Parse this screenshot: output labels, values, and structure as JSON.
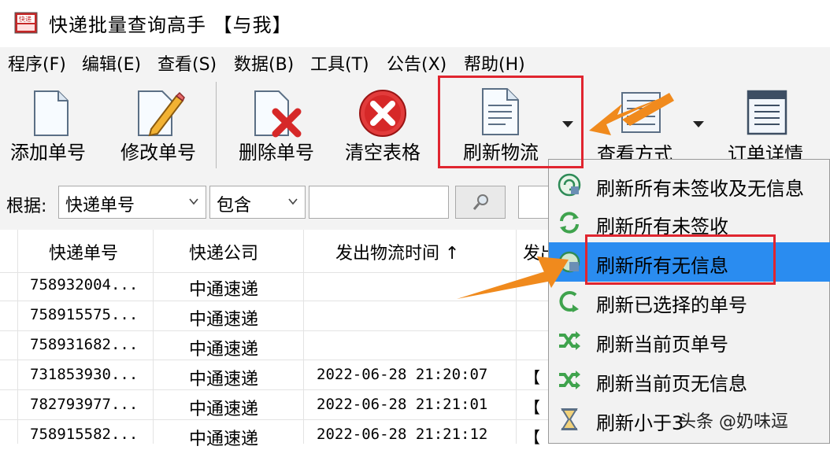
{
  "window": {
    "title": "快递批量查询高手 【与我】"
  },
  "menu": [
    "程序(F)",
    "编辑(E)",
    "查看(S)",
    "数据(B)",
    "工具(T)",
    "公告(X)",
    "帮助(H)"
  ],
  "toolbar": {
    "add": "添加单号",
    "edit": "修改单号",
    "delete": "删除单号",
    "clear": "清空表格",
    "refresh": "刷新物流",
    "view": "查看方式",
    "detail": "订单详情"
  },
  "filter": {
    "label": "根据:",
    "field": "快递单号",
    "op": "包含",
    "value": ""
  },
  "table": {
    "headers": [
      "快递单号",
      "快递公司",
      "发出物流时间 ↑",
      "发出"
    ],
    "rows": [
      {
        "no": "758932004...",
        "company": "中通速递",
        "time": "",
        "extra": ""
      },
      {
        "no": "758915575...",
        "company": "中通速递",
        "time": "",
        "extra": ""
      },
      {
        "no": "758931682...",
        "company": "中通速递",
        "time": "",
        "extra": ""
      },
      {
        "no": "731853930...",
        "company": "中通速递",
        "time": "2022-06-28 21:20:07",
        "extra": "【"
      },
      {
        "no": "782793977...",
        "company": "中通速递",
        "time": "2022-06-28 21:21:01",
        "extra": "【"
      },
      {
        "no": "758915582...",
        "company": "中通速递",
        "time": "2022-06-28 21:21:12",
        "extra": "【"
      }
    ]
  },
  "dropdown": [
    {
      "label": "刷新所有未签收及无信息",
      "icon": "refresh-info-icon"
    },
    {
      "label": "刷新所有未签收",
      "icon": "refresh-cycle-icon"
    },
    {
      "label": "刷新所有无信息",
      "icon": "refresh-info-icon",
      "selected": true
    },
    {
      "label": "刷新已选择的单号",
      "icon": "refresh-arrow-icon"
    },
    {
      "label": "刷新当前页单号",
      "icon": "shuffle-icon"
    },
    {
      "label": "刷新当前页无信息",
      "icon": "shuffle-icon"
    },
    {
      "label": "刷新小于3",
      "icon": "hourglass-icon"
    }
  ],
  "watermark": "头条 @奶味逗",
  "colors": {
    "highlight": "#2a8cf0",
    "annotation_box": "#e0252f",
    "annotation_arrow": "#f08a1d"
  }
}
